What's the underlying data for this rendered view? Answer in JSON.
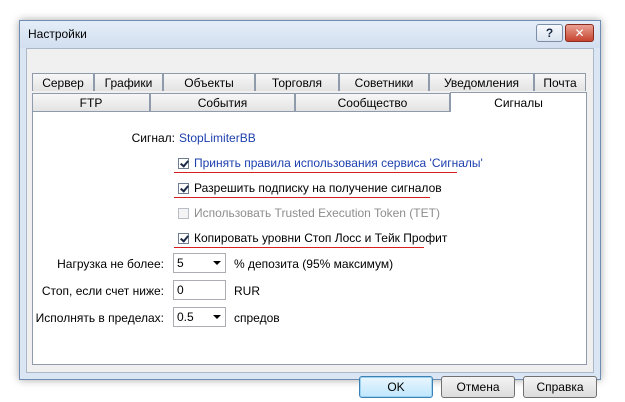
{
  "window": {
    "title": "Настройки",
    "help_label": "?",
    "close_label": "✕"
  },
  "tabs_row_back": [
    "Сервер",
    "Графики",
    "Объекты",
    "Торговля",
    "Советники",
    "Уведомления",
    "Почта"
  ],
  "tabs_row_front": [
    "FTP",
    "События",
    "Сообщество",
    "Сигналы"
  ],
  "active_tab": "Сигналы",
  "signal": {
    "label": "Сигнал:",
    "value": "StopLimiterBB"
  },
  "checkboxes": [
    {
      "label": "Принять правила использования сервиса 'Сигналы'",
      "checked": true,
      "enabled": true,
      "link": true
    },
    {
      "label": "Разрешить подписку на получение сигналов",
      "checked": true,
      "enabled": true,
      "link": false
    },
    {
      "label": "Использовать Trusted Execution Token (TET)",
      "checked": false,
      "enabled": false,
      "link": false
    },
    {
      "label": "Копировать уровни Стоп Лосс и Тейк Профит",
      "checked": true,
      "enabled": true,
      "link": false
    }
  ],
  "load": {
    "label": "Нагрузка не более:",
    "value": "5",
    "suffix": "% депозита (95% максимум)"
  },
  "stop": {
    "label": "Стоп, если счет ниже:",
    "value": "0",
    "suffix": "RUR"
  },
  "execute": {
    "label": "Исполнять в пределах:",
    "value": "0.5",
    "suffix": "спредов"
  },
  "buttons": {
    "ok": "OK",
    "cancel": "Отмена",
    "help": "Справка"
  },
  "colors": {
    "link": "#1c3fae",
    "annotation": "#d81f1f"
  }
}
